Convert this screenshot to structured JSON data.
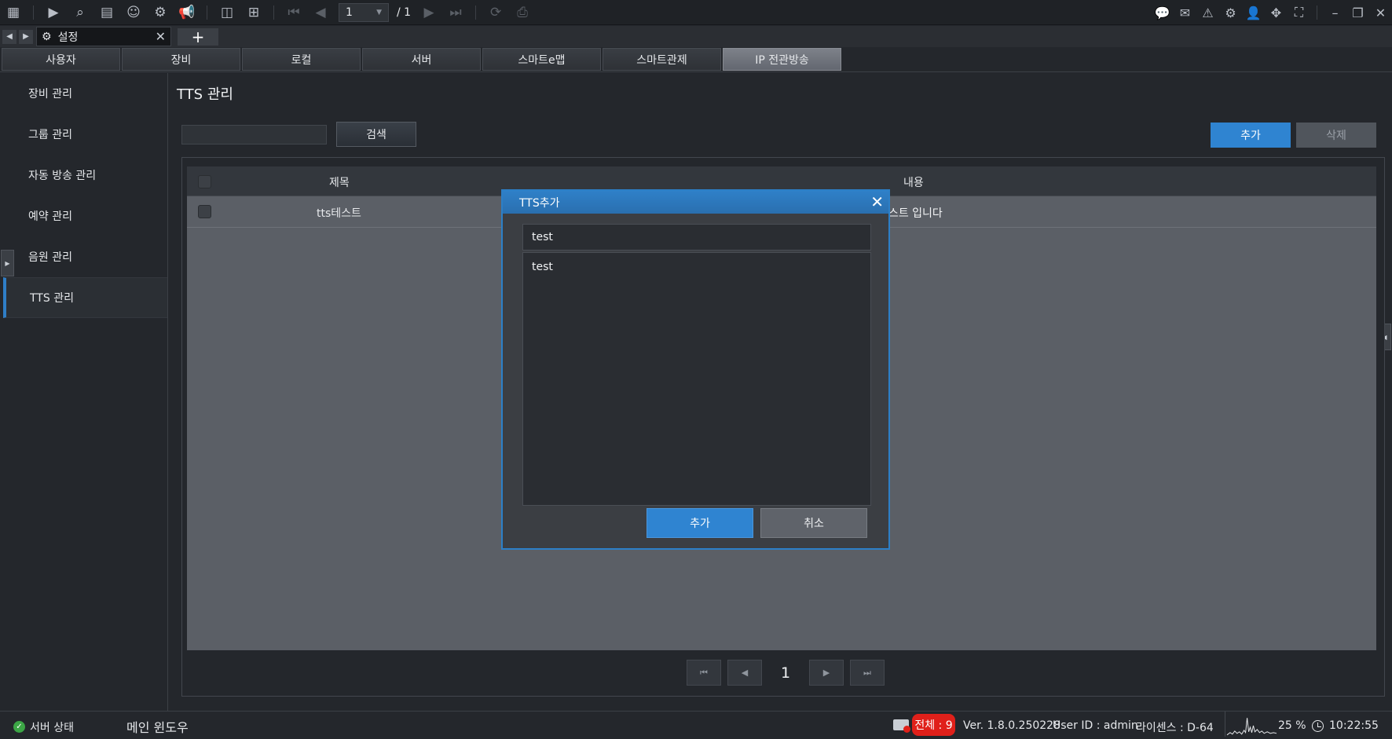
{
  "toolbar": {
    "page_current": "1",
    "page_total": "/ 1",
    "left_icons": [
      "grid-icon",
      "play-icon",
      "playback-search-icon",
      "event-list-icon",
      "face-search-icon",
      "vehicle-search-icon",
      "broadcast-icon"
    ],
    "right_icons": [
      "chat-icon",
      "message-icon",
      "alarm-icon",
      "settings-icon",
      "user-icon",
      "move-icon",
      "fullscreen-icon",
      "minimize-icon",
      "restore-icon",
      "close-icon"
    ]
  },
  "window_tab": {
    "title": "설정"
  },
  "category_tabs": [
    {
      "label": "사용자"
    },
    {
      "label": "장비"
    },
    {
      "label": "로컬"
    },
    {
      "label": "서버"
    },
    {
      "label": "스마트e맵"
    },
    {
      "label": "스마트관제"
    },
    {
      "label": "IP 전관방송",
      "active": true
    }
  ],
  "sidebar": {
    "items": [
      {
        "label": "장비 관리"
      },
      {
        "label": "그룹 관리"
      },
      {
        "label": "자동 방송 관리"
      },
      {
        "label": "예약 관리"
      },
      {
        "label": "음원 관리"
      },
      {
        "label": "TTS 관리",
        "active": true
      }
    ]
  },
  "main": {
    "title": "TTS 관리",
    "search_value": "",
    "search_label": "검색",
    "add_label": "추가",
    "delete_label": "삭제",
    "table": {
      "headers": [
        "제목",
        "내용"
      ],
      "rows": [
        {
          "title": "tts테스트",
          "content": "요. tts테스트 입니다"
        }
      ]
    },
    "pagination": {
      "current": "1"
    }
  },
  "modal": {
    "title": "TTS추가",
    "title_value": "test",
    "content_value": "test",
    "ok_label": "추가",
    "cancel_label": "취소"
  },
  "status": {
    "server_label": "서버 상태",
    "main_window_label": "메인 윈도우",
    "total": "전체 : 9",
    "version": "Ver. 1.8.0.250228",
    "user_id": "User ID : admin",
    "license": "라이센스 : D-64",
    "cpu": "25 %",
    "time": "10:22:55"
  },
  "colors": {
    "accent": "#2f84d1",
    "alert": "#e0201a",
    "ok": "#3ca646"
  }
}
